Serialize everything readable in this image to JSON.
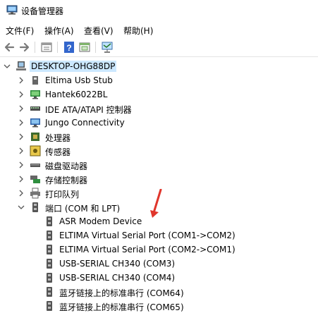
{
  "window": {
    "title": "设备管理器"
  },
  "menu": [
    {
      "label": "文件(F)"
    },
    {
      "label": "操作(A)"
    },
    {
      "label": "查看(V)"
    },
    {
      "label": "帮助(H)"
    }
  ],
  "toolbar": {
    "buttons": [
      "back-icon",
      "forward-icon",
      "properties-icon",
      "help-icon",
      "update-icon",
      "scan-hardware-icon"
    ]
  },
  "tree": {
    "root": {
      "label": "DESKTOP-OHG88DP"
    },
    "categories": [
      {
        "label": "Eltima Usb Stub",
        "icon": "usb-device-icon"
      },
      {
        "label": "Hantek6022BL",
        "icon": "monitor-icon"
      },
      {
        "label": "IDE ATA/ATAPI 控制器",
        "icon": "ide-controller-icon"
      },
      {
        "label": "Jungo Connectivity",
        "icon": "monitor-icon"
      },
      {
        "label": "处理器",
        "icon": "processor-icon"
      },
      {
        "label": "传感器",
        "icon": "sensor-icon"
      },
      {
        "label": "磁盘驱动器",
        "icon": "disk-drive-icon"
      },
      {
        "label": "存储控制器",
        "icon": "storage-controller-icon"
      },
      {
        "label": "打印队列",
        "icon": "printer-icon"
      },
      {
        "label": "端口 (COM 和 LPT)",
        "icon": "port-icon"
      }
    ],
    "ports": [
      {
        "label": "ASR Modem Device"
      },
      {
        "label": "ELTIMA Virtual Serial Port (COM1->COM2)"
      },
      {
        "label": "ELTIMA Virtual Serial Port (COM2->COM1)"
      },
      {
        "label": "USB-SERIAL CH340 (COM3)"
      },
      {
        "label": "USB-SERIAL CH340 (COM4)"
      },
      {
        "label": "蓝牙链接上的标准串行 (COM64)"
      },
      {
        "label": "蓝牙链接上的标准串行 (COM65)"
      }
    ]
  },
  "colors": {
    "selection": "#cce8ff",
    "arrow": "#e0362c",
    "chevron": "#555555"
  }
}
